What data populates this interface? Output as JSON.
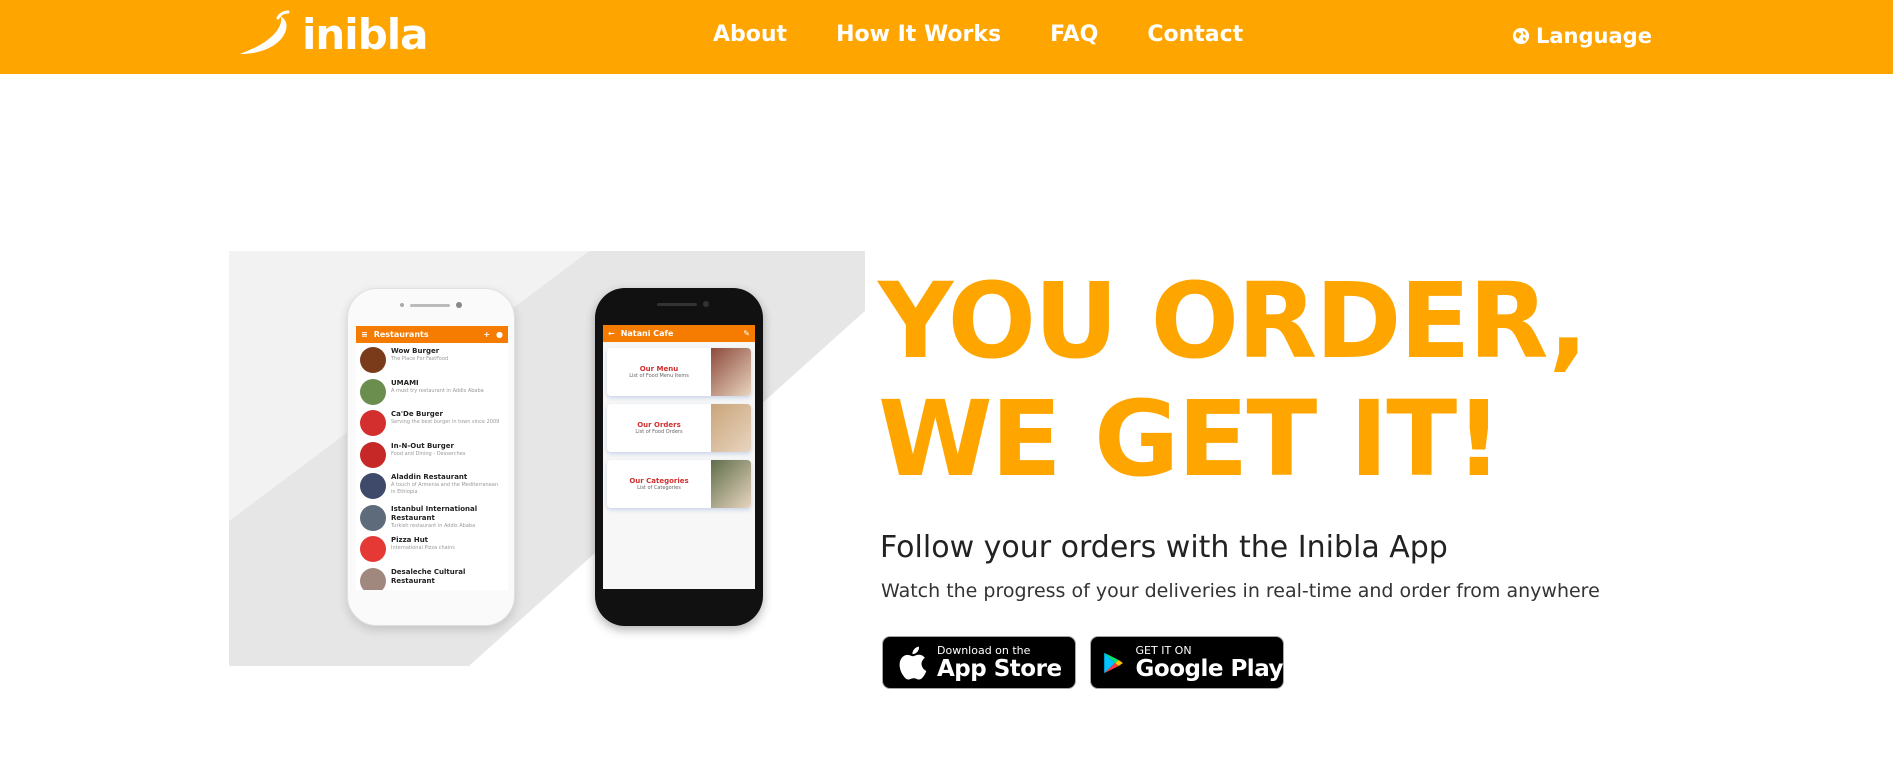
{
  "nav": {
    "logo_text": "inibla",
    "links": [
      "About",
      "How It Works",
      "FAQ",
      "Contact"
    ],
    "language_label": "Language"
  },
  "hero": {
    "headline_line1": "YOU ORDER,",
    "headline_line2": "WE GET IT!",
    "subtitle": "Follow your orders with the Inibla App",
    "description": "Watch the progress of your deliveries in real-time and order from anywhere"
  },
  "stores": {
    "apple_small": "Download on the",
    "apple_big": "App Store",
    "google_small": "GET IT ON",
    "google_big": "Google Play"
  },
  "phone_left": {
    "title": "Restaurants",
    "items": [
      {
        "name": "Wow Burger",
        "desc": "The Place For FastFood",
        "color": "#7a3b1a"
      },
      {
        "name": "UMAMI",
        "desc": "A must try restaurant in Addis Ababa",
        "color": "#6b8e4e"
      },
      {
        "name": "Ca'De Burger",
        "desc": "Serving the best burger in town since 2009",
        "color": "#d32f2f"
      },
      {
        "name": "In-N-Out Burger",
        "desc": "Food and Dining - Desserches",
        "color": "#c62828"
      },
      {
        "name": "Aladdin Restaurant",
        "desc": "A touch of Armenia and the Mediterranean in Ethiopia",
        "color": "#3f4a6b"
      },
      {
        "name": "Istanbul International Restaurant",
        "desc": "Turkish restaurant in Addis Ababa",
        "color": "#5d6b7a"
      },
      {
        "name": "Pizza Hut",
        "desc": "International Pizza chains",
        "color": "#e53935"
      },
      {
        "name": "Desaleche Cultural  Restaurant",
        "desc": "",
        "color": "#a1887f"
      }
    ]
  },
  "phone_right": {
    "title": "Natani Cafe",
    "cards": [
      {
        "title": "Our Menu",
        "sub": "List of Food Menu Items",
        "color": "#8d4a3b"
      },
      {
        "title": "Our Orders",
        "sub": "List of Food Orders",
        "color": "#c9a57a"
      },
      {
        "title": "Our Categories",
        "sub": "List of Categories",
        "color": "#5f6e4a"
      }
    ]
  }
}
